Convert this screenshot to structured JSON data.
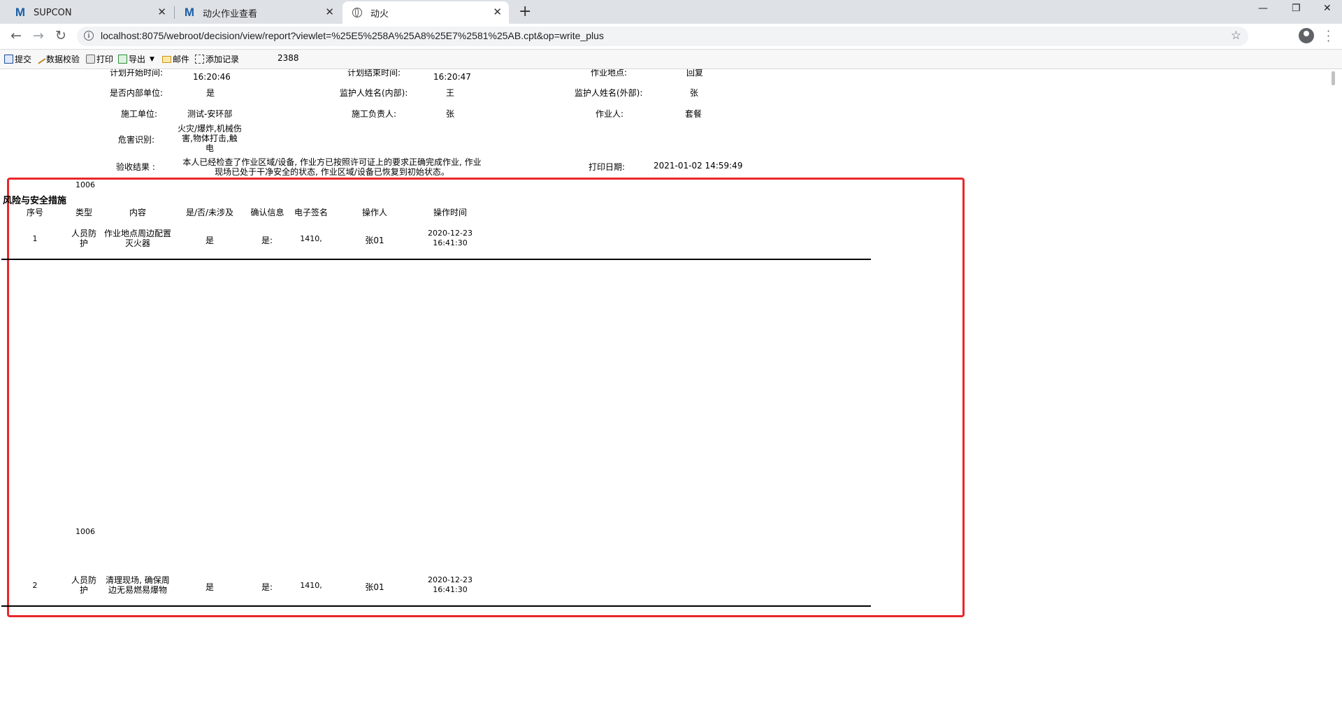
{
  "browser": {
    "tabs": [
      {
        "title": "SUPCON",
        "icon": "M"
      },
      {
        "title": "动火作业查看",
        "icon": "M"
      },
      {
        "title": "动火",
        "icon": "globe"
      }
    ],
    "url": "localhost:8075/webroot/decision/view/report?viewlet=%25E5%258A%25A8%25E7%2581%25AB.cpt&op=write_plus"
  },
  "toolbar": {
    "submit": "提交",
    "validate": "数据校验",
    "print": "打印",
    "export": "导出",
    "mail": "邮件",
    "add_record": "添加记录",
    "number": "2388"
  },
  "report": {
    "header": {
      "plan_start_label": "计划开始时间:",
      "plan_start_time": "16:20:46",
      "plan_end_label": "计划结束时间:",
      "plan_end_time": "16:20:47",
      "location_label": "作业地点:",
      "location_value": "回复",
      "internal_label": "是否内部单位:",
      "internal_value": "是",
      "guardian_internal_label": "监护人姓名(内部):",
      "guardian_internal_value": "王",
      "guardian_external_label": "监护人姓名(外部):",
      "guardian_external_value": "张",
      "unit_label": "施工单位:",
      "unit_value": "测试-安环部",
      "leader_label": "施工负责人:",
      "leader_value": "张",
      "worker_label": "作业人:",
      "worker_value": "套餐",
      "hazard_label": "危害识别:",
      "hazard_lines": [
        "火灾/爆炸,机械伤",
        "害,物体打击,触",
        "电"
      ],
      "acceptance_label": "验收结果 :",
      "acceptance_lines": [
        "本人已经检查了作业区域/设备, 作业方已按照许可证上的要求正确完成作业, 作业",
        "现场已处于干净安全的状态, 作业区域/设备已恢复到初始状态。"
      ],
      "print_date_label": "打印日期:",
      "print_date_value": "2021-01-02 14:59:49"
    },
    "section_title": "风险与安全措施",
    "columns": [
      "序号",
      "类型",
      "内容",
      "是/否/未涉及",
      "确认信息",
      "电子签名",
      "操作人",
      "操作时间"
    ],
    "rows": [
      {
        "code": "1006",
        "seq": "1",
        "type_lines": [
          "人员防",
          "护"
        ],
        "content_lines": [
          "作业地点周边配置",
          "灭火器"
        ],
        "yes": "是",
        "confirm": "是:",
        "sign": "1410,",
        "operator": "张01",
        "time_lines": [
          "2020-12-23",
          "16:41:30"
        ]
      },
      {
        "code": "1006",
        "seq": "2",
        "type_lines": [
          "人员防",
          "护"
        ],
        "content_lines": [
          "清理现场, 确保周",
          "边无易燃易爆物"
        ],
        "yes": "是",
        "confirm": "是:",
        "sign": "1410,",
        "operator": "张01",
        "time_lines": [
          "2020-12-23",
          "16:41:30"
        ]
      }
    ]
  }
}
